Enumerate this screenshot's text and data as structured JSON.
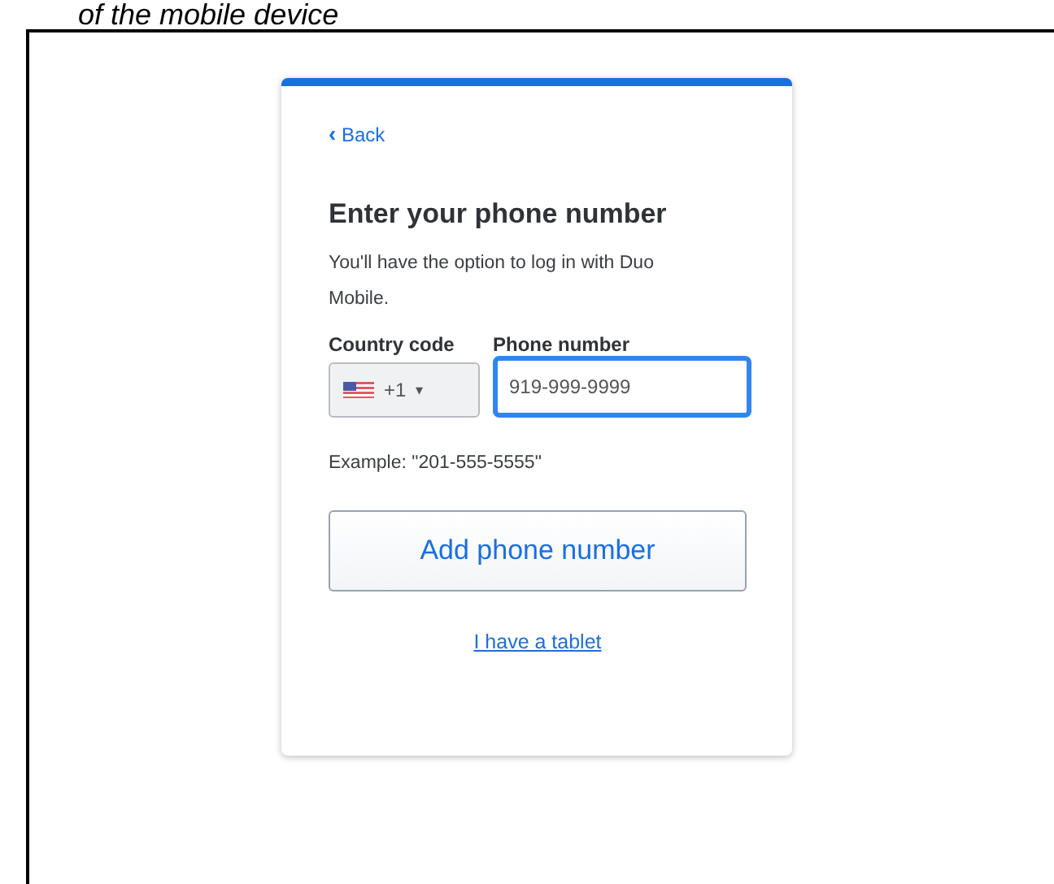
{
  "caption": "of the mobile device",
  "card": {
    "back": {
      "icon": "‹",
      "label": "Back"
    },
    "title": "Enter your phone number",
    "description": "You'll have the option to log in with Duo Mobile.",
    "country": {
      "label": "Country code",
      "value": "+1",
      "caret": "▾"
    },
    "phone": {
      "label": "Phone number",
      "value": "919-999-9999",
      "focused": true
    },
    "example": "Example: \"201-555-5555\"",
    "button": "Add phone number",
    "link": "I have a tablet"
  }
}
